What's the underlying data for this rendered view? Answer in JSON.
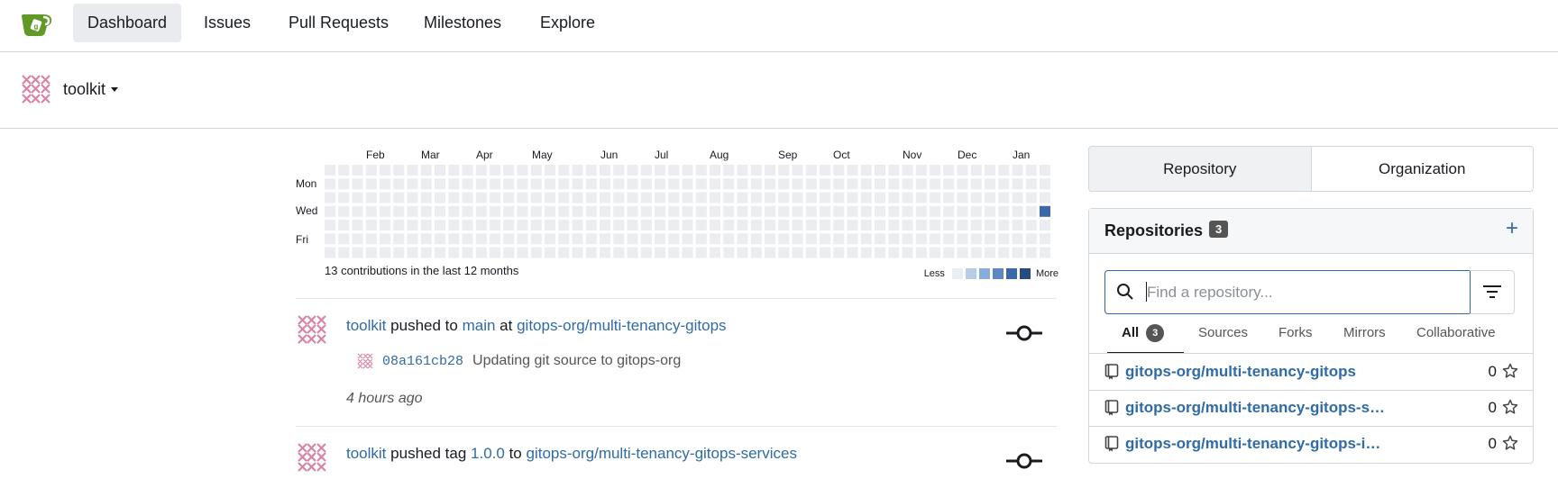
{
  "nav": {
    "items": [
      "Dashboard",
      "Issues",
      "Pull Requests",
      "Milestones",
      "Explore"
    ],
    "active": "Dashboard"
  },
  "context": {
    "name": "toolkit"
  },
  "heatmap": {
    "months": [
      "Feb",
      "Mar",
      "Apr",
      "May",
      "Jun",
      "Jul",
      "Aug",
      "Sep",
      "Oct",
      "Nov",
      "Dec",
      "Jan"
    ],
    "days": [
      "Mon",
      "Wed",
      "Fri"
    ],
    "weeks": 53,
    "active_cell": {
      "week": 52,
      "day": 3
    },
    "total_text": "13 contributions in the last 12 months",
    "legend_less": "Less",
    "legend_more": "More",
    "colors": [
      "#ebedf0",
      "#b8cbe7",
      "#8aabdb",
      "#5b87c4",
      "#3a68a8",
      "#264b7f"
    ]
  },
  "feed": [
    {
      "user": "toolkit",
      "action": "pushed to",
      "ref": "main",
      "prep": "at",
      "repo": "gitops-org/multi-tenancy-gitops",
      "commit_sha": "08a161cb28",
      "commit_msg": "Updating git source to gitops-org",
      "time": "4 hours ago"
    },
    {
      "user": "toolkit",
      "action": "pushed tag",
      "ref": "1.0.0",
      "prep": "to",
      "repo": "gitops-org/multi-tenancy-gitops-services"
    }
  ],
  "sidebar": {
    "tabs": [
      "Repository",
      "Organization"
    ],
    "active_tab": "Repository",
    "panel_title": "Repositories",
    "repo_count": "3",
    "add_label": "+",
    "search_placeholder": "Find a repository...",
    "filters": [
      "All",
      "Sources",
      "Forks",
      "Mirrors",
      "Collaborative"
    ],
    "all_count": "3",
    "repos": [
      {
        "name": "gitops-org/multi-tenancy-gitops",
        "stars": "0"
      },
      {
        "name": "gitops-org/multi-tenancy-gitops-services",
        "stars": "0"
      },
      {
        "name": "gitops-org/multi-tenancy-gitops-infra",
        "stars": "0"
      }
    ]
  }
}
